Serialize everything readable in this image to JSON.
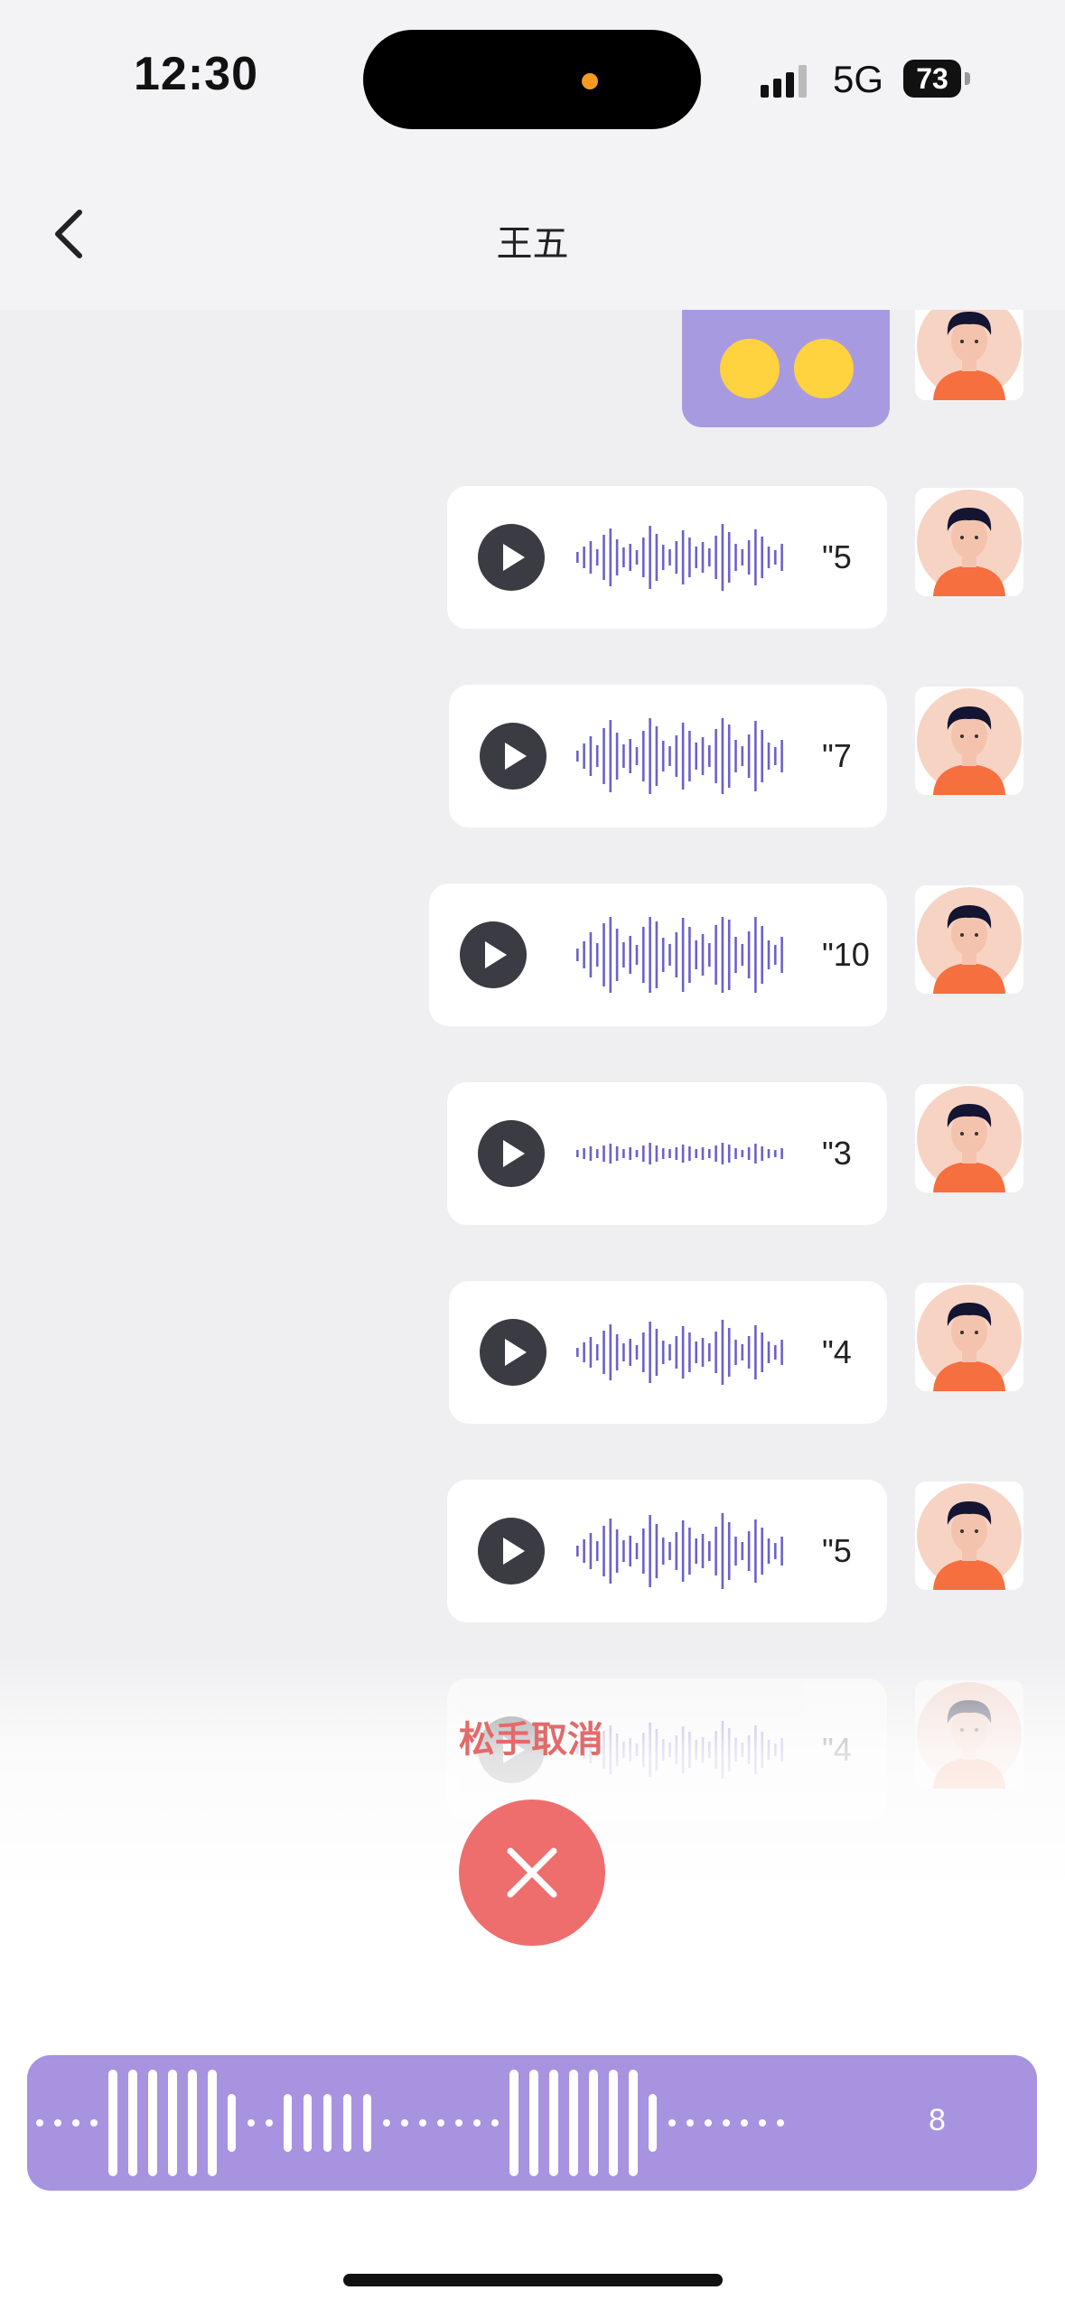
{
  "status_bar": {
    "time": "12:30",
    "network": "5G",
    "battery": "73"
  },
  "nav": {
    "title": "王五",
    "back_icon": "chevron-left-icon"
  },
  "messages": [
    {
      "type": "emoji",
      "emojis": [
        "😒",
        "😒"
      ]
    },
    {
      "type": "voice",
      "duration": "\"5"
    },
    {
      "type": "voice",
      "duration": "\"7"
    },
    {
      "type": "voice",
      "duration": "\"10"
    },
    {
      "type": "voice",
      "duration": "\"3"
    },
    {
      "type": "voice",
      "duration": "\"4"
    },
    {
      "type": "voice",
      "duration": "\"5"
    },
    {
      "type": "voice",
      "duration": "\"4"
    }
  ],
  "recording": {
    "cancel_hint": "松手取消",
    "seconds": "8"
  },
  "colors": {
    "accent": "#a793e0",
    "wave": "#6b62c9",
    "cancel": "#ee6e6e",
    "play_button": "#3b3b44"
  }
}
